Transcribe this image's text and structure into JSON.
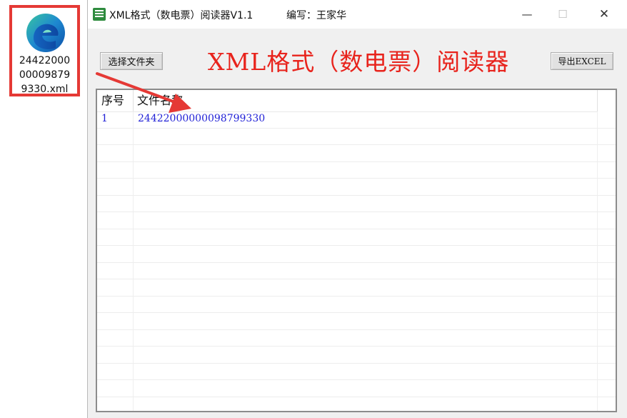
{
  "desktop_file": {
    "name": "24422000000098799330.xml",
    "icon": "edge-icon",
    "highlight_color": "#e53935"
  },
  "window": {
    "title": "XML格式（数电票）阅读器V1.1",
    "author": "编写：王家华",
    "controls": {
      "minimize": "—",
      "maximize": "☐",
      "close": "✕"
    }
  },
  "toolbar": {
    "select_file_label": "选择文件夹",
    "heading": "XML格式（数电票）阅读器",
    "export_label": "导出EXCEL"
  },
  "list": {
    "columns": [
      "序号",
      "文件名称"
    ],
    "rows": [
      {
        "no": "1",
        "name": "24422000000098799330"
      }
    ]
  },
  "colors": {
    "heading": "#e8231c",
    "row_text": "#1f1fd6",
    "annotation_arrow": "#e53935"
  }
}
